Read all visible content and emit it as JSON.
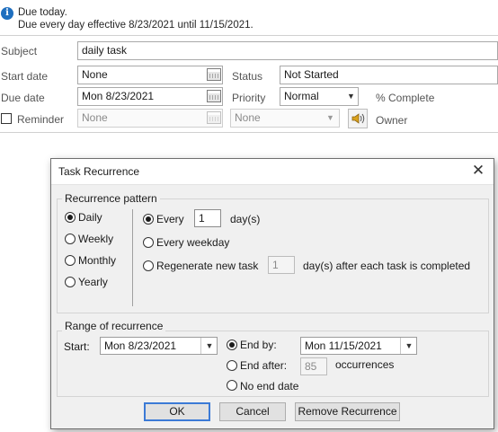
{
  "info": {
    "line1": "Due today.",
    "line2": "Due every day effective 8/23/2021 until 11/15/2021."
  },
  "form": {
    "subject_label": "Subject",
    "subject_value": "daily task",
    "start_label": "Start date",
    "start_value": "None",
    "due_label": "Due date",
    "due_value": "Mon 8/23/2021",
    "status_label": "Status",
    "status_value": "Not Started",
    "priority_label": "Priority",
    "priority_value": "Normal",
    "percent_label": "% Complete",
    "reminder_label": "Reminder",
    "reminder_date": "None",
    "reminder_time": "None",
    "owner_label": "Owner"
  },
  "dialog": {
    "title": "Task Recurrence",
    "pattern": {
      "legend": "Recurrence pattern",
      "daily": "Daily",
      "weekly": "Weekly",
      "monthly": "Monthly",
      "yearly": "Yearly",
      "every_label": "Every",
      "every_value": "1",
      "every_unit": "day(s)",
      "every_weekday": "Every weekday",
      "regenerate": "Regenerate new task",
      "regenerate_value": "1",
      "regenerate_suffix": "day(s) after each task is completed"
    },
    "range": {
      "legend": "Range of recurrence",
      "start_label": "Start:",
      "start_value": "Mon 8/23/2021",
      "end_by": "End by:",
      "end_by_value": "Mon 11/15/2021",
      "end_after": "End after:",
      "end_after_value": "85",
      "occurrences": "occurrences",
      "no_end": "No end date"
    },
    "buttons": {
      "ok": "OK",
      "cancel": "Cancel",
      "remove": "Remove Recurrence"
    }
  },
  "colors": {
    "accent": "#3b7ad6",
    "info_icon": "#1f6fbf",
    "dialog_bg": "#f0f0f0"
  }
}
